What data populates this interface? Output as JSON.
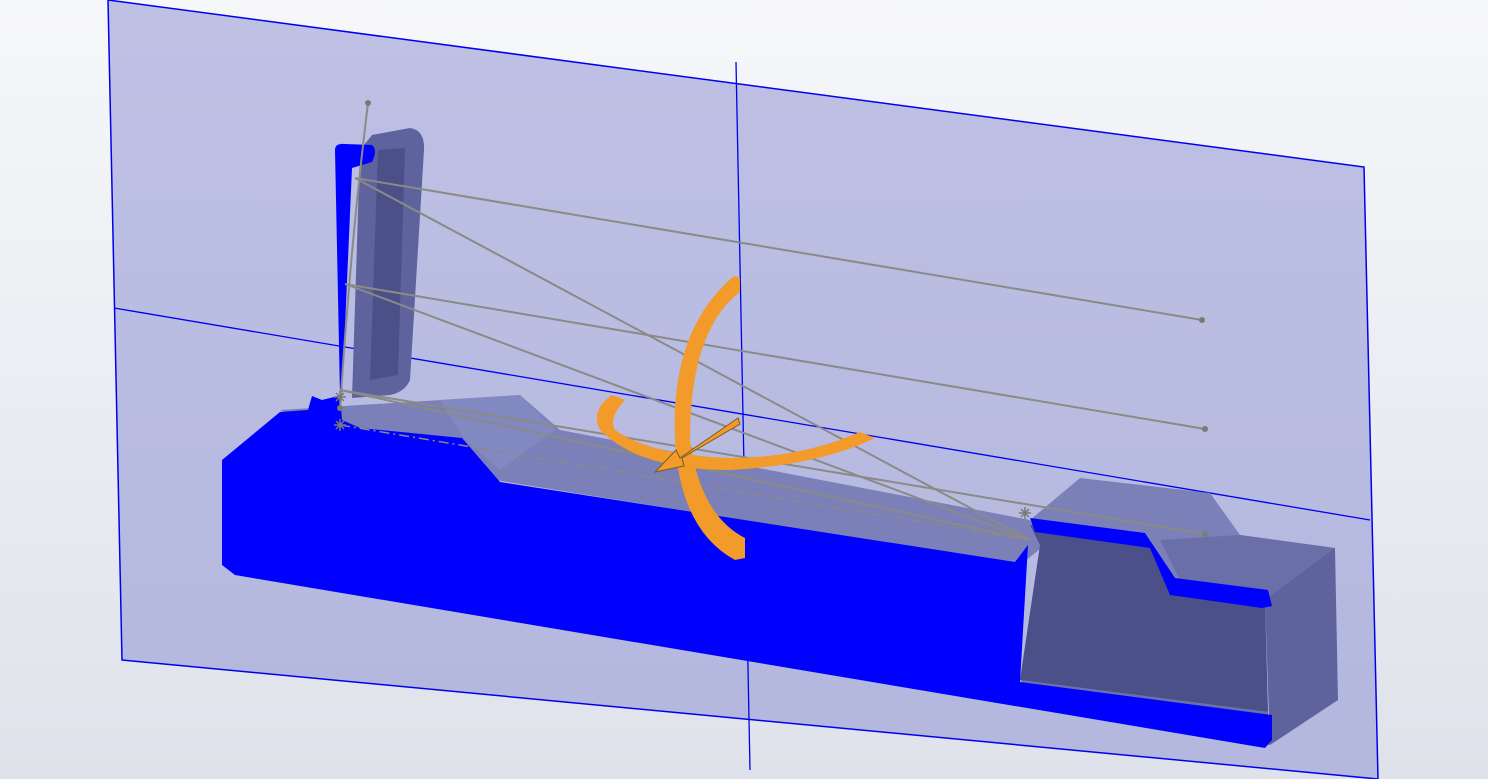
{
  "viewport": {
    "background_top": "#f6f7f9",
    "background_bottom": "#dfe2ea"
  },
  "colors": {
    "plane_fill": "#8f93d3",
    "plane_edge": "#0000ee",
    "section_face": "#0000ff",
    "model_light": "#7b80b8",
    "model_mid": "#6a6fa8",
    "model_dark": "#4b5088",
    "sketch_line": "#8a8a86",
    "triad": "#f39b2a"
  },
  "icons": {
    "sketch_points": "point-marker-icon",
    "rotation_triad": "rotate-triad-icon"
  }
}
